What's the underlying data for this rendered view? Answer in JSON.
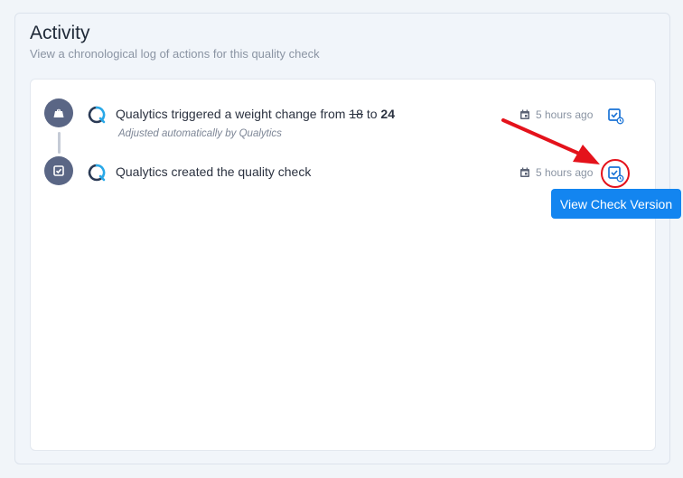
{
  "activity": {
    "title": "Activity",
    "subtitle": "View a chronological log of actions for this quality check"
  },
  "entries": [
    {
      "node_icon": "weight-icon",
      "text_prefix": "Qualytics triggered a weight change from ",
      "old_value": "18",
      "connector_word": " to ",
      "new_value": "24",
      "subtext": "Adjusted automatically by Qualytics",
      "time": "5 hours ago"
    },
    {
      "node_icon": "check-square-icon",
      "text": "Qualytics created the quality check",
      "time": "5 hours ago"
    }
  ],
  "tooltip": {
    "label": "View Check Version"
  },
  "colors": {
    "node": "#5a6685",
    "accent": "#1385f0",
    "annotation": "#e4121b"
  }
}
